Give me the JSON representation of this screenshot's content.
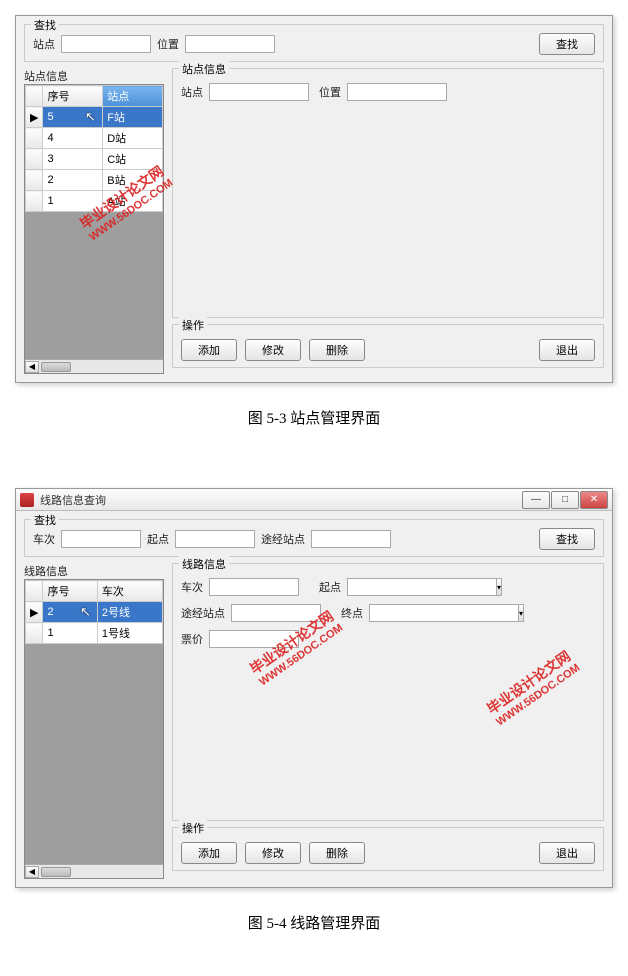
{
  "watermark": {
    "cn": "毕业设计论文网",
    "url": "WWW.56DOC.COM"
  },
  "captions": {
    "fig53": "图 5-3 站点管理界面",
    "fig54": "图 5-4 线路管理界面"
  },
  "panel1": {
    "search": {
      "group": "查找",
      "label_station": "站点",
      "label_position": "位置",
      "button": "查找"
    },
    "left": {
      "label": "站点信息",
      "col_index": "序号",
      "col_station": "站点",
      "rows": [
        {
          "idx": "5",
          "name": "F站"
        },
        {
          "idx": "4",
          "name": "D站"
        },
        {
          "idx": "3",
          "name": "C站"
        },
        {
          "idx": "2",
          "name": "B站"
        },
        {
          "idx": "1",
          "name": "A站"
        }
      ],
      "row_marker": "▶"
    },
    "info": {
      "group": "站点信息",
      "label_station": "站点",
      "label_position": "位置"
    },
    "ops": {
      "group": "操作",
      "add": "添加",
      "modify": "修改",
      "delete": "删除",
      "exit": "退出"
    }
  },
  "panel2": {
    "title": "线路信息查询",
    "win": {
      "min": "—",
      "max": "□",
      "close": "✕"
    },
    "search": {
      "group": "查找",
      "label_train": "车次",
      "label_start": "起点",
      "label_via": "途经站点",
      "button": "查找"
    },
    "left": {
      "label": "线路信息",
      "col_index": "序号",
      "col_train": "车次",
      "rows": [
        {
          "idx": "2",
          "name": "2号线"
        },
        {
          "idx": "1",
          "name": "1号线"
        }
      ],
      "row_marker": "▶"
    },
    "info": {
      "group": "线路信息",
      "label_train": "车次",
      "label_start": "起点",
      "label_via": "途经站点",
      "label_end": "终点",
      "label_price": "票价"
    },
    "ops": {
      "group": "操作",
      "add": "添加",
      "modify": "修改",
      "delete": "删除",
      "exit": "退出"
    }
  }
}
